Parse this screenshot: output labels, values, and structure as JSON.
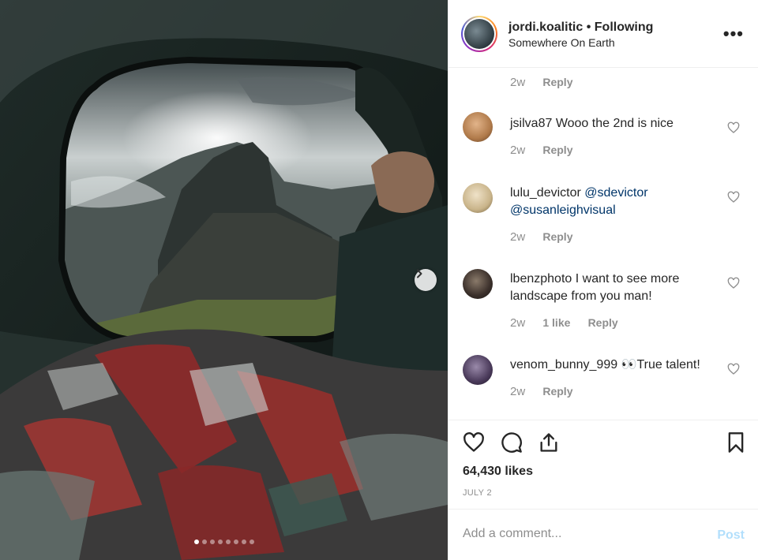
{
  "post": {
    "username": "jordi.koalitic",
    "separator": "•",
    "follow_status": "Following",
    "location": "Somewhere On Earth",
    "more": "•••"
  },
  "comments": {
    "top_meta": {
      "age": "2w",
      "reply": "Reply"
    },
    "items": [
      {
        "user": "jsilva87",
        "text": "Wooo the 2nd is nice",
        "age": "2w",
        "reply": "Reply",
        "avatar_color": "#b07a4a"
      },
      {
        "user": "lulu_devictor",
        "text_mentions": [
          "@sdevictor",
          "@susanleighvisual"
        ],
        "age": "2w",
        "reply": "Reply",
        "avatar_color": "#c9b48a"
      },
      {
        "user": "lbenzphoto",
        "text": "I want to see more landscape from you man!",
        "age": "2w",
        "likes": "1 like",
        "reply": "Reply",
        "avatar_color": "#3a2f2a"
      },
      {
        "user": "venom_bunny_999",
        "emoji": "👀",
        "text": "True talent!",
        "age": "2w",
        "reply": "Reply",
        "avatar_color": "#4a3a5a"
      }
    ]
  },
  "actions": {
    "likes": "64,430 likes",
    "date": "JULY 2"
  },
  "add_comment": {
    "placeholder": "Add a comment...",
    "post": "Post"
  },
  "carousel": {
    "count": 8,
    "active_index": 0
  },
  "colors": {
    "link": "#003569",
    "muted": "#8e8e8e",
    "post_disabled": "#b2dffc"
  }
}
